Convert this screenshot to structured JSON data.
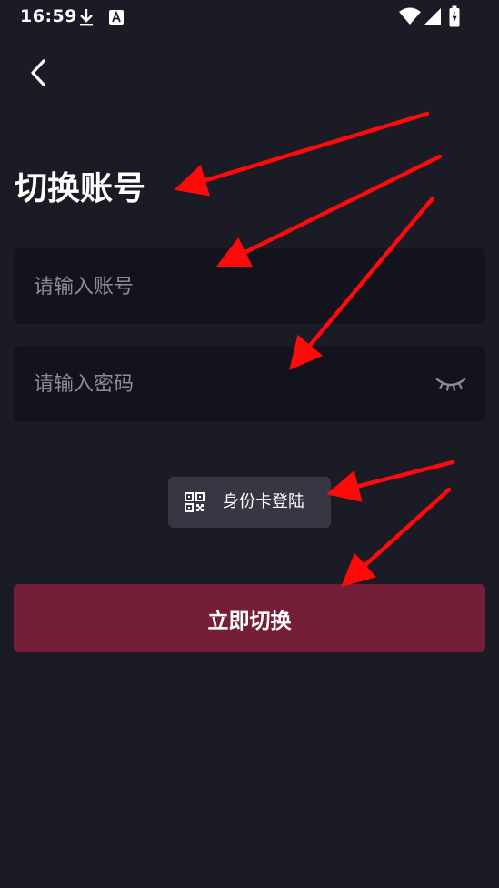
{
  "status_bar": {
    "time": "16:59",
    "icons": [
      "download-icon",
      "keyboard-a-icon",
      "wifi-icon",
      "cellular-signal-icon",
      "battery-charging-icon"
    ]
  },
  "header": {
    "back_icon": "chevron-left-icon"
  },
  "title": "切换账号",
  "account_field": {
    "placeholder": "请输入账号",
    "value": ""
  },
  "password_field": {
    "placeholder": "请输入密码",
    "value": "",
    "toggle_icon": "eye-closed-icon"
  },
  "id_card_login": {
    "icon": "qr-code-icon",
    "label": "身份卡登陆"
  },
  "switch_button": {
    "label": "立即切换"
  },
  "colors": {
    "background": "#1b1b26",
    "field_background": "#12131d",
    "chip_background": "#363743",
    "primary_button": "#741f37",
    "annotation_arrow": "#ff0a0a"
  },
  "annotations": {
    "arrow_count": 5
  }
}
